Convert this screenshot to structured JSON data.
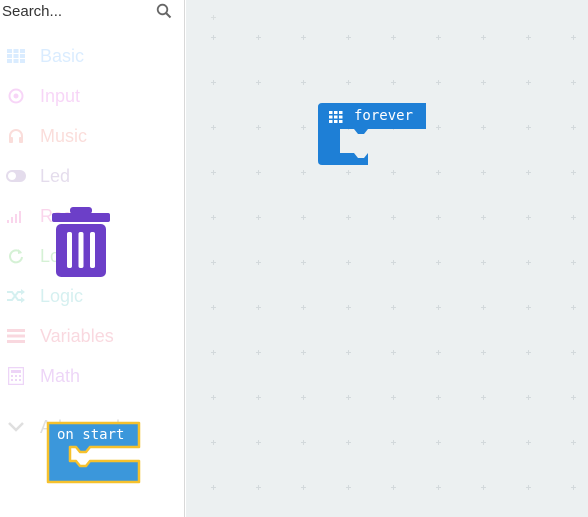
{
  "toolbox": {
    "search": {
      "placeholder": "Search...",
      "value": ""
    },
    "categories": [
      {
        "label": "Basic",
        "icon": "grid-icon",
        "color": "#1e90ff"
      },
      {
        "label": "Input",
        "icon": "target-icon",
        "color": "#d400d4"
      },
      {
        "label": "Music",
        "icon": "headphones-icon",
        "color": "#e63022"
      },
      {
        "label": "Led",
        "icon": "toggle-icon",
        "color": "#5c2d91"
      },
      {
        "label": "Radio",
        "icon": "signal-bars-icon",
        "color": "#e3008c"
      },
      {
        "label": "Loops",
        "icon": "refresh-icon",
        "color": "#00aa00"
      },
      {
        "label": "Logic",
        "icon": "shuffle-icon",
        "color": "#00a4a6"
      },
      {
        "label": "Variables",
        "icon": "list-lines-icon",
        "color": "#dc143c"
      },
      {
        "label": "Math",
        "icon": "calculator-icon",
        "color": "#9400d3"
      },
      {
        "label": "Advanced",
        "icon": "chevron-down-icon",
        "color": "#3c3c3c"
      }
    ],
    "trash_color": "#6c3fc8"
  },
  "workspace": {
    "forever_block": {
      "label": "forever",
      "color": "#1e7fd6"
    },
    "on_start_block": {
      "label": "on start",
      "color": "#3b97db",
      "highlight": "#f6c12d"
    }
  }
}
